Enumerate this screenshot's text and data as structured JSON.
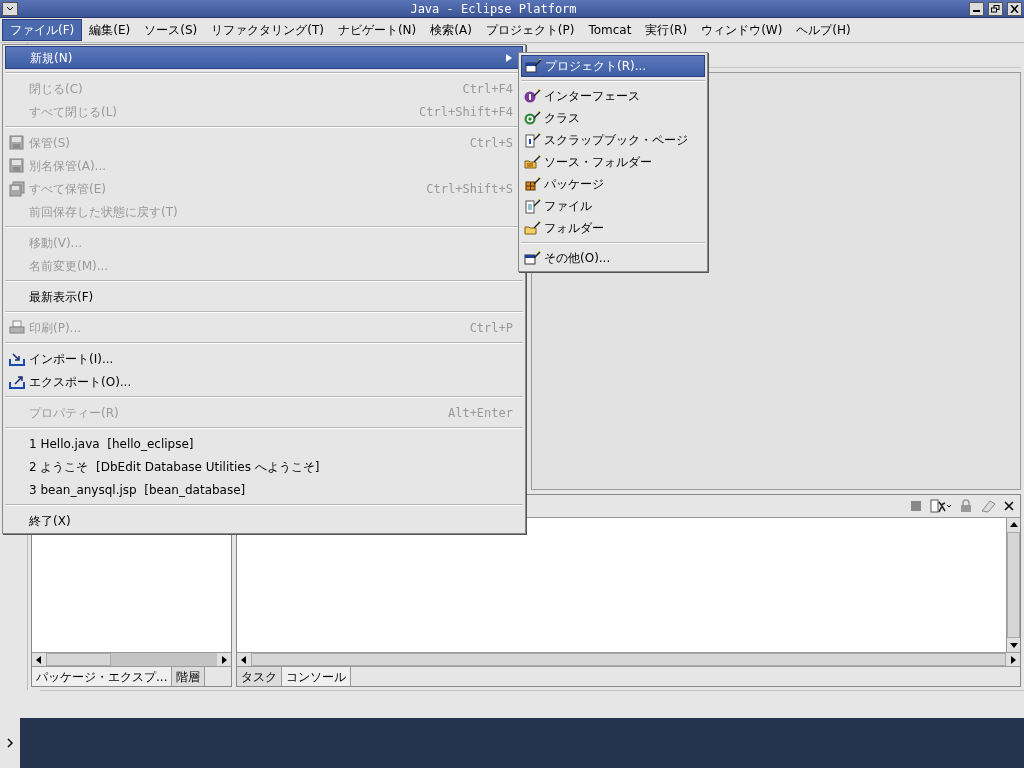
{
  "window": {
    "title": "Java - Eclipse Platform"
  },
  "menubar": [
    {
      "label": "ファイル(F)",
      "selected": true
    },
    {
      "label": "編集(E)",
      "selected": false
    },
    {
      "label": "ソース(S)",
      "selected": false
    },
    {
      "label": "リファクタリング(T)",
      "selected": false
    },
    {
      "label": "ナビゲート(N)",
      "selected": false
    },
    {
      "label": "検索(A)",
      "selected": false
    },
    {
      "label": "プロジェクト(P)",
      "selected": false
    },
    {
      "label": "Tomcat",
      "selected": false
    },
    {
      "label": "実行(R)",
      "selected": false
    },
    {
      "label": "ウィンドウ(W)",
      "selected": false
    },
    {
      "label": "ヘルプ(H)",
      "selected": false
    }
  ],
  "file_menu": {
    "groups": [
      [
        {
          "label": "新規(N)",
          "kind": "plain",
          "selected": true,
          "disabled": false,
          "submenu": true
        }
      ],
      [
        {
          "label": "閉じる(C)",
          "shortcut": "Ctrl+F4",
          "kind": "plain",
          "selected": false,
          "disabled": true,
          "submenu": false
        },
        {
          "label": "すべて閉じる(L)",
          "shortcut": "Ctrl+Shift+F4",
          "kind": "plain",
          "selected": false,
          "disabled": true,
          "submenu": false
        }
      ],
      [
        {
          "label": "保管(S)",
          "shortcut": "Ctrl+S",
          "kind": "disk",
          "selected": false,
          "disabled": true,
          "submenu": false
        },
        {
          "label": "別名保管(A)...",
          "kind": "disk",
          "selected": false,
          "disabled": true,
          "submenu": false
        },
        {
          "label": "すべて保管(E)",
          "shortcut": "Ctrl+Shift+S",
          "kind": "disks",
          "selected": false,
          "disabled": true,
          "submenu": false
        },
        {
          "label": "前回保存した状態に戻す(T)",
          "kind": "plain",
          "selected": false,
          "disabled": true,
          "submenu": false
        }
      ],
      [
        {
          "label": "移動(V)...",
          "kind": "plain",
          "selected": false,
          "disabled": true,
          "submenu": false
        },
        {
          "label": "名前変更(M)...",
          "kind": "plain",
          "selected": false,
          "disabled": true,
          "submenu": false
        }
      ],
      [
        {
          "label": "最新表示(F)",
          "kind": "plain",
          "selected": false,
          "disabled": false,
          "submenu": false
        }
      ],
      [
        {
          "label": "印刷(P)...",
          "shortcut": "Ctrl+P",
          "kind": "printer",
          "selected": false,
          "disabled": true,
          "submenu": false
        }
      ],
      [
        {
          "label": "インポート(I)...",
          "kind": "import",
          "selected": false,
          "disabled": false,
          "submenu": false
        },
        {
          "label": "エクスポート(O)...",
          "kind": "export",
          "selected": false,
          "disabled": false,
          "submenu": false
        }
      ],
      [
        {
          "label": "プロパティー(R)",
          "shortcut": "Alt+Enter",
          "kind": "plain",
          "selected": false,
          "disabled": true,
          "submenu": false
        }
      ],
      [
        {
          "label": "1 Hello.java  [hello_eclipse]",
          "kind": "plain",
          "selected": false,
          "disabled": false,
          "submenu": false
        },
        {
          "label": "2 ようこそ  [DbEdit Database Utilities へようこそ]",
          "kind": "plain",
          "selected": false,
          "disabled": false,
          "submenu": false
        },
        {
          "label": "3 bean_anysql.jsp  [bean_database]",
          "kind": "plain",
          "selected": false,
          "disabled": false,
          "submenu": false
        }
      ],
      [
        {
          "label": "終了(X)",
          "kind": "plain",
          "selected": false,
          "disabled": false,
          "submenu": false
        }
      ]
    ]
  },
  "new_submenu": {
    "groups": [
      [
        {
          "label": "プロジェクト(R)...",
          "kind": "window",
          "selected": true
        }
      ],
      [
        {
          "label": "インターフェース",
          "kind": "interface",
          "selected": false
        },
        {
          "label": "クラス",
          "kind": "class",
          "selected": false
        },
        {
          "label": "スクラップブック・ページ",
          "kind": "page",
          "selected": false
        },
        {
          "label": "ソース・フォルダー",
          "kind": "srcfolder",
          "selected": false
        },
        {
          "label": "パッケージ",
          "kind": "package",
          "selected": false
        },
        {
          "label": "ファイル",
          "kind": "file",
          "selected": false
        },
        {
          "label": "フォルダー",
          "kind": "folder",
          "selected": false
        }
      ],
      [
        {
          "label": "その他(O)...",
          "kind": "window",
          "selected": false
        }
      ]
    ]
  },
  "left_view": {
    "tabs": [
      {
        "label": "パッケージ・エクスプ...",
        "selected": true
      },
      {
        "label": "階層",
        "selected": false
      }
    ]
  },
  "bottom_view": {
    "tabs": [
      {
        "label": "タスク",
        "selected": false
      },
      {
        "label": "コンソール",
        "selected": true
      }
    ]
  }
}
